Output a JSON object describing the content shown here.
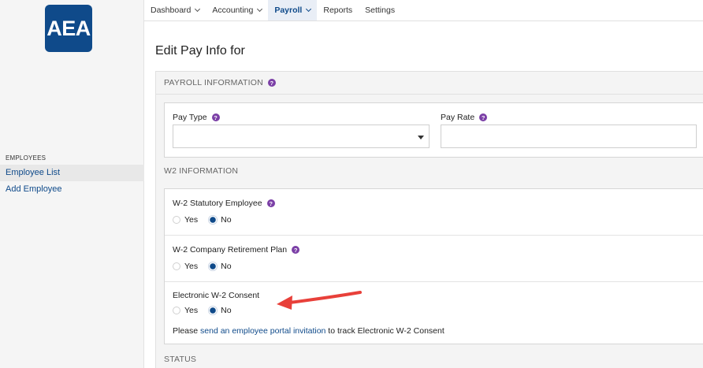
{
  "logo": {
    "text": "AEA"
  },
  "sidebar": {
    "section_title": "EMPLOYEES",
    "items": [
      {
        "label": "Employee List",
        "active": true
      },
      {
        "label": "Add Employee",
        "active": false
      }
    ]
  },
  "nav": {
    "items": [
      {
        "label": "Dashboard",
        "dropdown": true
      },
      {
        "label": "Accounting",
        "dropdown": true
      },
      {
        "label": "Payroll",
        "dropdown": true,
        "active": true
      },
      {
        "label": "Reports",
        "dropdown": false
      },
      {
        "label": "Settings",
        "dropdown": false
      }
    ]
  },
  "page": {
    "title": "Edit Pay Info for"
  },
  "payroll_info": {
    "header": "PAYROLL INFORMATION",
    "pay_type_label": "Pay Type",
    "pay_type_value": "",
    "pay_rate_label": "Pay Rate",
    "pay_rate_value": ""
  },
  "w2_info": {
    "header": "W2 INFORMATION",
    "statutory_label": "W-2 Statutory Employee",
    "retirement_label": "W-2 Company Retirement Plan",
    "consent_label": "Electronic W-2 Consent",
    "yes_label": "Yes",
    "no_label": "No",
    "statutory_selected": "No",
    "retirement_selected": "No",
    "consent_selected": "No",
    "consent_note_prefix": "Please ",
    "consent_note_link": "send an employee portal invitation",
    "consent_note_suffix": " to track Electronic W-2 Consent"
  },
  "status": {
    "header": "STATUS"
  },
  "help_glyph": "?",
  "colors": {
    "brand": "#0f4a8a",
    "help": "#7b3fa6",
    "annotation_arrow": "#e8403a"
  }
}
